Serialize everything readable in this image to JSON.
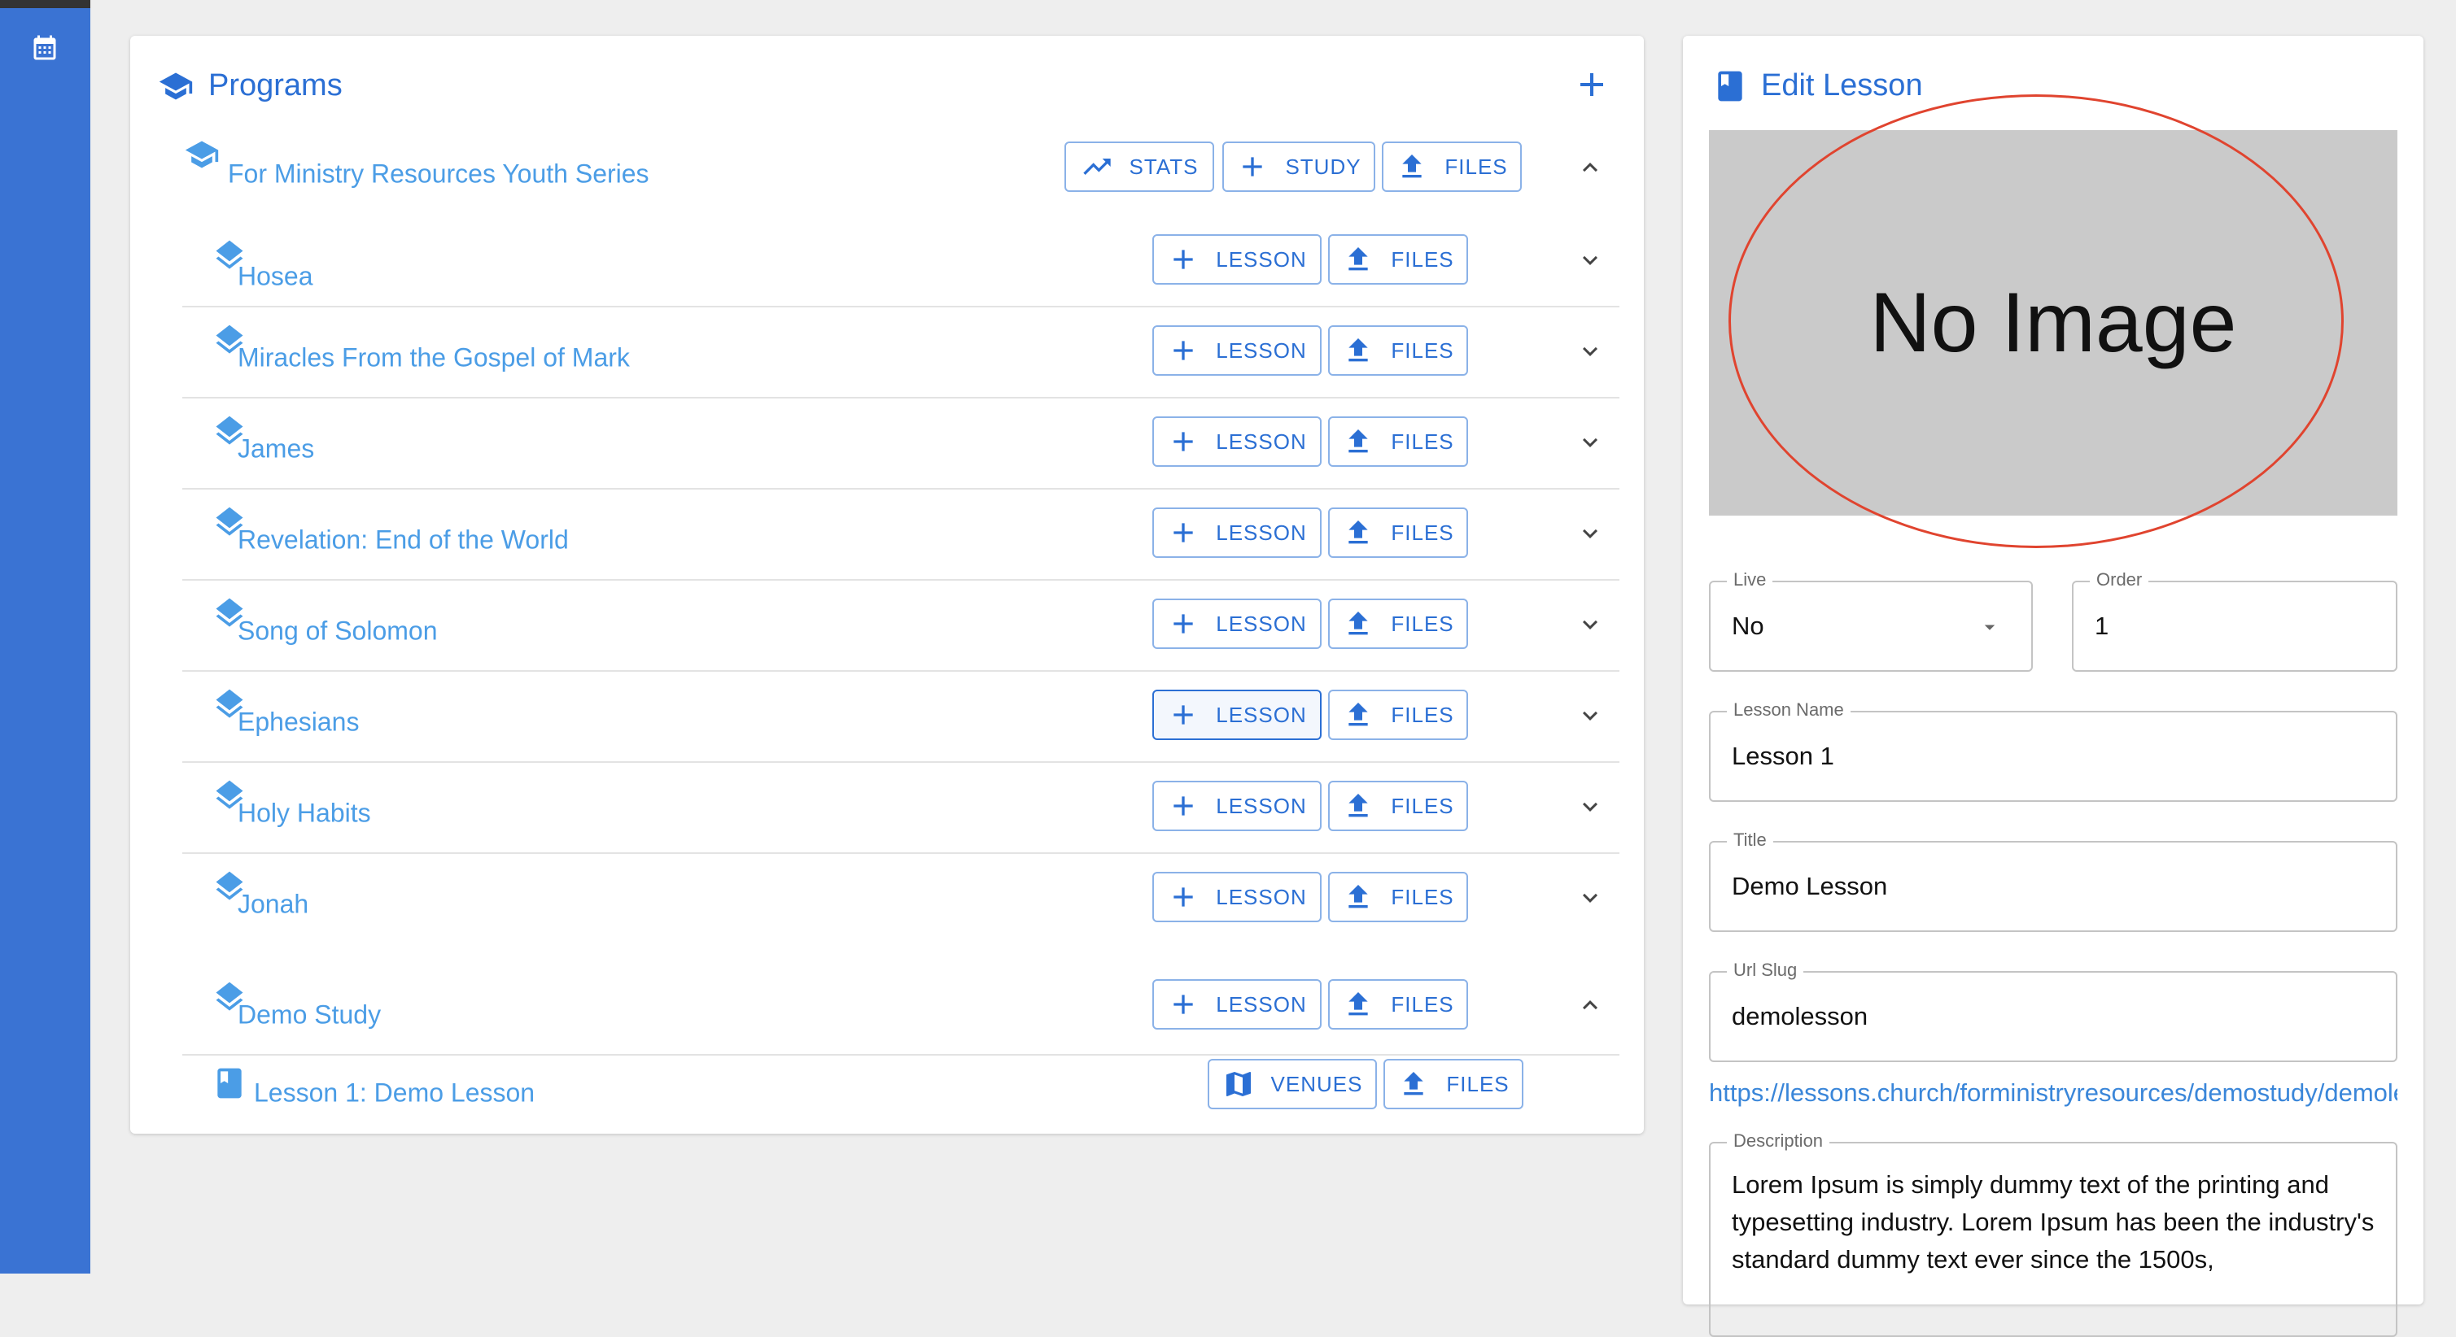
{
  "programs": {
    "title": "Programs",
    "program": {
      "name": "For Ministry Resources Youth Series",
      "stats_label": "STATS",
      "study_label": "STUDY",
      "files_label": "FILES"
    },
    "studies": [
      {
        "name": "Hosea",
        "lesson_label": "LESSON",
        "files_label": "FILES"
      },
      {
        "name": "Miracles From the Gospel of Mark",
        "lesson_label": "LESSON",
        "files_label": "FILES"
      },
      {
        "name": "James",
        "lesson_label": "LESSON",
        "files_label": "FILES"
      },
      {
        "name": "Revelation: End of the World",
        "lesson_label": "LESSON",
        "files_label": "FILES"
      },
      {
        "name": "Song of Solomon",
        "lesson_label": "LESSON",
        "files_label": "FILES"
      },
      {
        "name": "Ephesians",
        "lesson_label": "LESSON",
        "files_label": "FILES"
      },
      {
        "name": "Holy Habits",
        "lesson_label": "LESSON",
        "files_label": "FILES"
      },
      {
        "name": "Jonah",
        "lesson_label": "LESSON",
        "files_label": "FILES"
      },
      {
        "name": "Demo Study",
        "lesson_label": "LESSON",
        "files_label": "FILES"
      }
    ],
    "lesson": {
      "name": "Lesson 1: Demo Lesson",
      "venues_label": "VENUES",
      "files_label": "FILES"
    }
  },
  "edit": {
    "title": "Edit Lesson",
    "image_placeholder": "No Image",
    "live": {
      "label": "Live",
      "value": "No"
    },
    "order": {
      "label": "Order",
      "value": "1"
    },
    "lesson_name": {
      "label": "Lesson Name",
      "value": "Lesson 1"
    },
    "lesson_title": {
      "label": "Title",
      "value": "Demo Lesson"
    },
    "url_slug": {
      "label": "Url Slug",
      "value": "demolesson"
    },
    "url": "https://lessons.church/forministryresources/demostudy/demolesson",
    "description": {
      "label": "Description",
      "value": "Lorem Ipsum is simply dummy text of the printing and typesetting industry. Lorem Ipsum has been the industry's standard dummy text ever since the 1500s,"
    }
  },
  "colors": {
    "accent": "#2b6fd4",
    "link": "#4b9de6",
    "sidebar": "#3a73d3",
    "annotation": "#e0442f"
  }
}
